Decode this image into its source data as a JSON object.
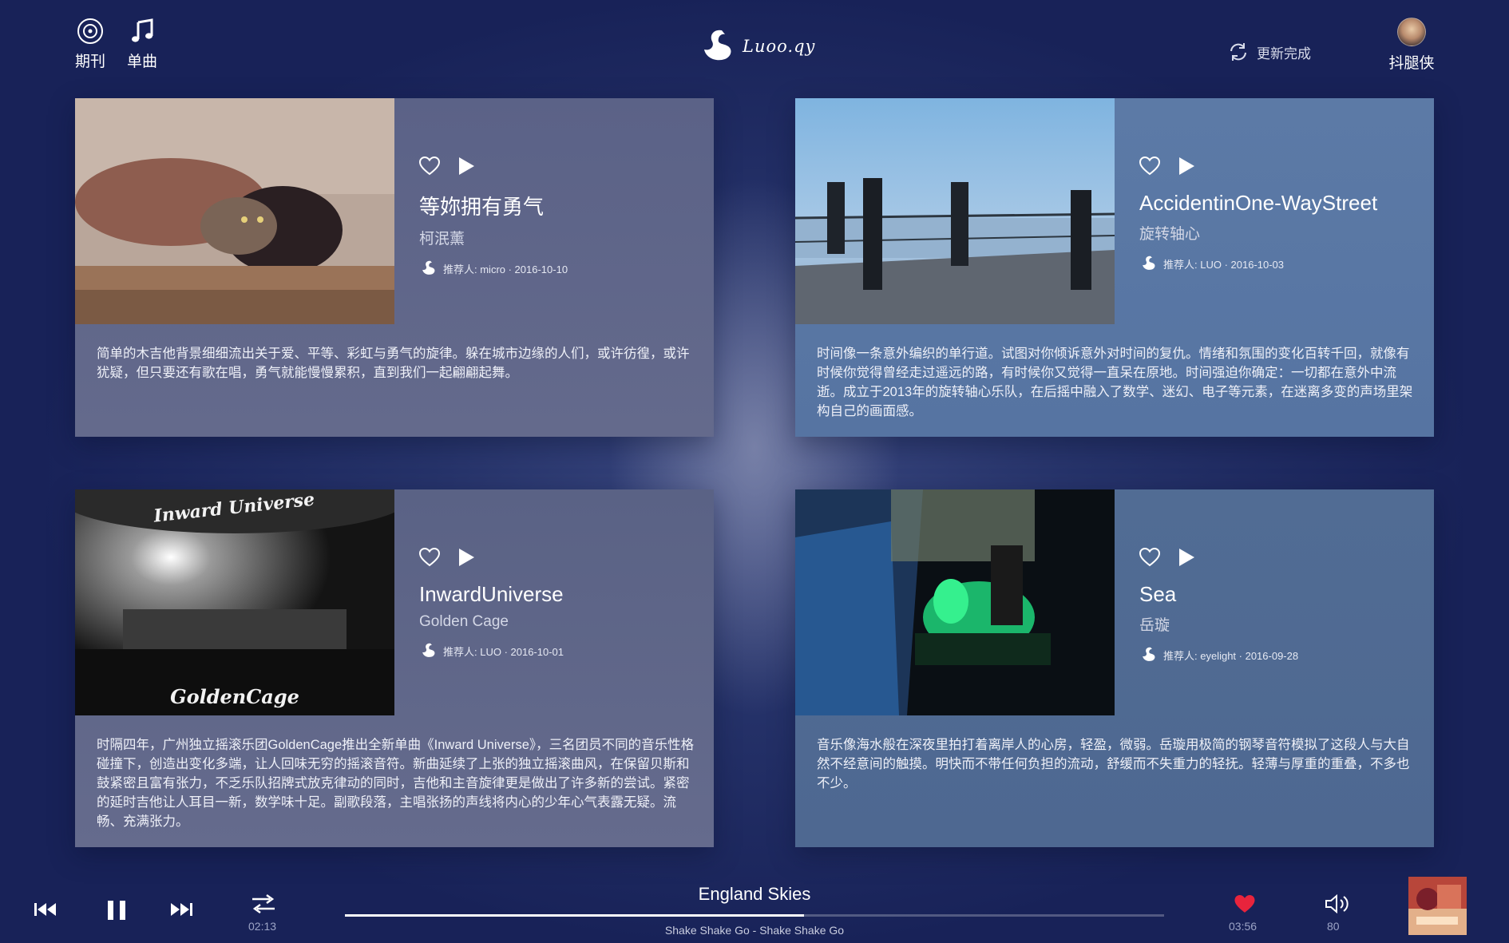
{
  "nav": {
    "journal_label": "期刊",
    "single_label": "单曲"
  },
  "logo": {
    "text": "Luoo.qy"
  },
  "refresh": {
    "label": "更新完成"
  },
  "user": {
    "name": "抖腿侠"
  },
  "cards": [
    {
      "title": "等妳拥有勇气",
      "artist": "柯泯薰",
      "recommender": "推荐人: micro · 2016-10-10",
      "description": "简单的木吉他背景细细流出关于爱、平等、彩虹与勇气的旋律。躲在城市边缘的人们，或许彷徨，或许犹疑，但只要还有歌在唱，勇气就能慢慢累积，直到我们一起翩翩起舞。"
    },
    {
      "title": "AccidentinOne-WayStreet",
      "artist": "旋转轴心",
      "recommender": "推荐人: LUO · 2016-10-03",
      "description": "时间像一条意外编织的单行道。试图对你倾诉意外对时间的复仇。情绪和氛围的变化百转千回，就像有时候你觉得曾经走过遥远的路，有时候你又觉得一直呆在原地。时间强迫你确定：一切都在意外中流逝。成立于2013年的旋转轴心乐队，在后摇中融入了数学、迷幻、电子等元素，在迷离多变的声场里架构自己的画面感。"
    },
    {
      "title": "InwardUniverse",
      "artist": "Golden Cage",
      "recommender": "推荐人: LUO · 2016-10-01",
      "description": "时隔四年，广州独立摇滚乐团GoldenCage推出全新单曲《Inward Universe》，三名团员不同的音乐性格碰撞下，创造出变化多端，让人回味无穷的摇滚音符。新曲延续了上张的独立摇滚曲风，在保留贝斯和鼓紧密且富有张力，不乏乐队招牌式放克律动的同时，吉他和主音旋律更是做出了许多新的尝试。紧密的延时吉他让人耳目一新，数学味十足。副歌段落，主唱张扬的声线将内心的少年心气表露无疑。流畅、充满张力。",
      "cover_text_top": "Inward Universe",
      "cover_text_bottom": "GoldenCage"
    },
    {
      "title": "Sea",
      "artist": "岳璇",
      "recommender": "推荐人: eyelight · 2016-09-28",
      "description": "音乐像海水般在深夜里拍打着离岸人的心房，轻盈，微弱。岳璇用极简的钢琴音符模拟了这段人与大自然不经意间的触摸。明快而不带任何负担的流动，舒缓而不失重力的轻抚。轻薄与厚重的重叠，不多也不少。"
    }
  ],
  "player": {
    "elapsed": "02:13",
    "total": "03:56",
    "progress": 0.56,
    "track_title": "England Skies",
    "track_subtitle": "Shake Shake Go - Shake Shake Go",
    "volume": "80",
    "liked_color": "#e8243c"
  }
}
